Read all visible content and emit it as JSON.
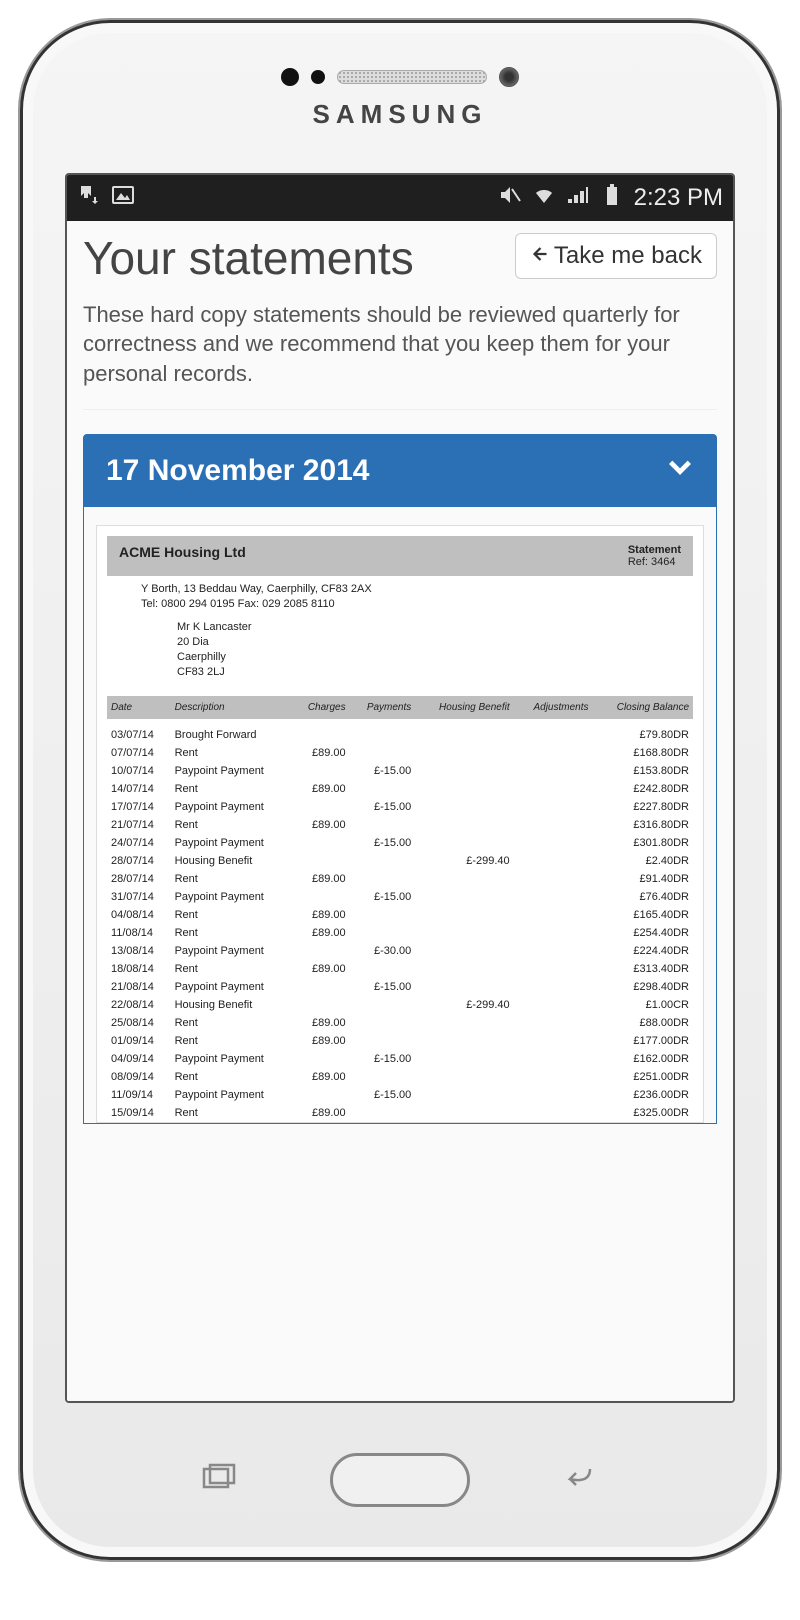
{
  "device": {
    "brand": "SAMSUNG"
  },
  "status_bar": {
    "time": "2:23 PM"
  },
  "header": {
    "title": "Your statements",
    "back_button": "Take me back",
    "intro": "These hard copy statements should be reviewed quarterly for correctness and we recommend that you keep them for your personal records."
  },
  "accordion": {
    "date_label": "17 November 2014"
  },
  "statement": {
    "company": "ACME Housing Ltd",
    "statement_label": "Statement",
    "ref_label": "Ref: 3464",
    "address_line": "Y Borth, 13 Beddau Way, Caerphilly, CF83 2AX",
    "contact_line": "Tel: 0800 294 0195 Fax: 029 2085 8110",
    "recipient": [
      "Mr K Lancaster",
      "20 Dia",
      "Caerphilly",
      "CF83 2LJ"
    ],
    "columns": {
      "date": "Date",
      "description": "Description",
      "charges": "Charges",
      "payments": "Payments",
      "housing_benefit": "Housing Benefit",
      "adjustments": "Adjustments",
      "closing_balance": "Closing Balance"
    },
    "rows": [
      {
        "date": "03/07/14",
        "desc": "Brought Forward",
        "charges": "",
        "payments": "",
        "hb": "",
        "adj": "",
        "bal": "£79.80DR"
      },
      {
        "date": "07/07/14",
        "desc": "Rent",
        "charges": "£89.00",
        "payments": "",
        "hb": "",
        "adj": "",
        "bal": "£168.80DR"
      },
      {
        "date": "10/07/14",
        "desc": "Paypoint Payment",
        "charges": "",
        "payments": "£-15.00",
        "hb": "",
        "adj": "",
        "bal": "£153.80DR"
      },
      {
        "date": "14/07/14",
        "desc": "Rent",
        "charges": "£89.00",
        "payments": "",
        "hb": "",
        "adj": "",
        "bal": "£242.80DR"
      },
      {
        "date": "17/07/14",
        "desc": "Paypoint Payment",
        "charges": "",
        "payments": "£-15.00",
        "hb": "",
        "adj": "",
        "bal": "£227.80DR"
      },
      {
        "date": "21/07/14",
        "desc": "Rent",
        "charges": "£89.00",
        "payments": "",
        "hb": "",
        "adj": "",
        "bal": "£316.80DR"
      },
      {
        "date": "24/07/14",
        "desc": "Paypoint Payment",
        "charges": "",
        "payments": "£-15.00",
        "hb": "",
        "adj": "",
        "bal": "£301.80DR"
      },
      {
        "date": "28/07/14",
        "desc": "Housing Benefit",
        "charges": "",
        "payments": "",
        "hb": "£-299.40",
        "adj": "",
        "bal": "£2.40DR"
      },
      {
        "date": "28/07/14",
        "desc": "Rent",
        "charges": "£89.00",
        "payments": "",
        "hb": "",
        "adj": "",
        "bal": "£91.40DR"
      },
      {
        "date": "31/07/14",
        "desc": "Paypoint Payment",
        "charges": "",
        "payments": "£-15.00",
        "hb": "",
        "adj": "",
        "bal": "£76.40DR"
      },
      {
        "date": "04/08/14",
        "desc": "Rent",
        "charges": "£89.00",
        "payments": "",
        "hb": "",
        "adj": "",
        "bal": "£165.40DR"
      },
      {
        "date": "11/08/14",
        "desc": "Rent",
        "charges": "£89.00",
        "payments": "",
        "hb": "",
        "adj": "",
        "bal": "£254.40DR"
      },
      {
        "date": "13/08/14",
        "desc": "Paypoint Payment",
        "charges": "",
        "payments": "£-30.00",
        "hb": "",
        "adj": "",
        "bal": "£224.40DR"
      },
      {
        "date": "18/08/14",
        "desc": "Rent",
        "charges": "£89.00",
        "payments": "",
        "hb": "",
        "adj": "",
        "bal": "£313.40DR"
      },
      {
        "date": "21/08/14",
        "desc": "Paypoint Payment",
        "charges": "",
        "payments": "£-15.00",
        "hb": "",
        "adj": "",
        "bal": "£298.40DR"
      },
      {
        "date": "22/08/14",
        "desc": "Housing Benefit",
        "charges": "",
        "payments": "",
        "hb": "£-299.40",
        "adj": "",
        "bal": "£1.00CR"
      },
      {
        "date": "25/08/14",
        "desc": "Rent",
        "charges": "£89.00",
        "payments": "",
        "hb": "",
        "adj": "",
        "bal": "£88.00DR"
      },
      {
        "date": "01/09/14",
        "desc": "Rent",
        "charges": "£89.00",
        "payments": "",
        "hb": "",
        "adj": "",
        "bal": "£177.00DR"
      },
      {
        "date": "04/09/14",
        "desc": "Paypoint Payment",
        "charges": "",
        "payments": "£-15.00",
        "hb": "",
        "adj": "",
        "bal": "£162.00DR"
      },
      {
        "date": "08/09/14",
        "desc": "Rent",
        "charges": "£89.00",
        "payments": "",
        "hb": "",
        "adj": "",
        "bal": "£251.00DR"
      },
      {
        "date": "11/09/14",
        "desc": "Paypoint Payment",
        "charges": "",
        "payments": "£-15.00",
        "hb": "",
        "adj": "",
        "bal": "£236.00DR"
      },
      {
        "date": "15/09/14",
        "desc": "Rent",
        "charges": "£89.00",
        "payments": "",
        "hb": "",
        "adj": "",
        "bal": "£325.00DR"
      }
    ]
  }
}
